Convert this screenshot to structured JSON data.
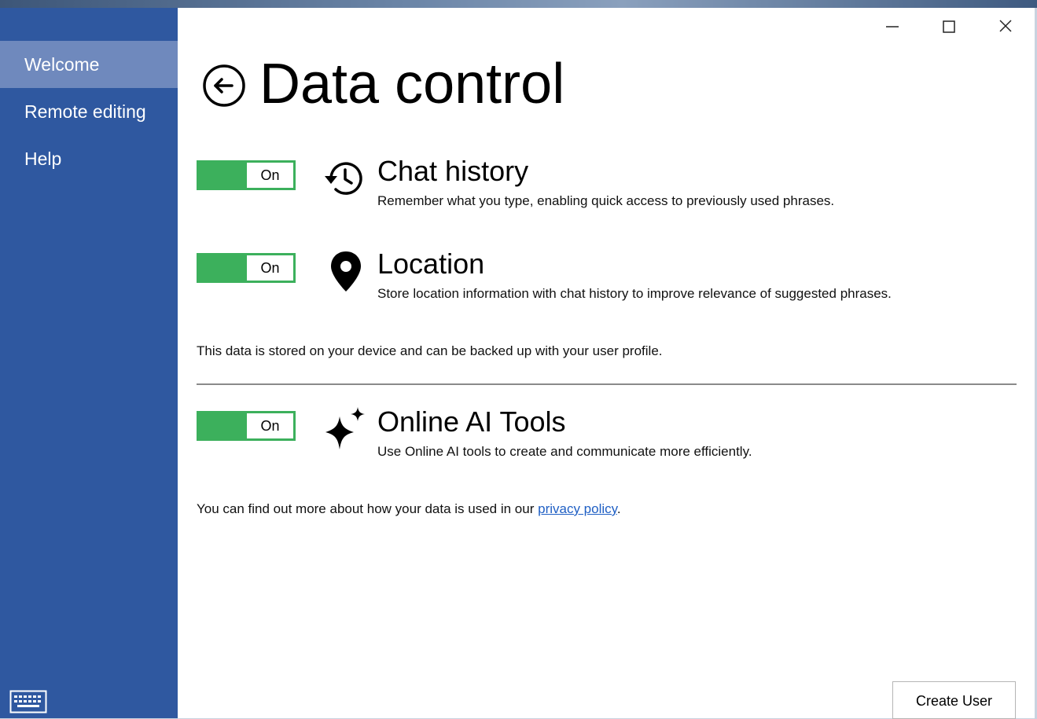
{
  "sidebar": {
    "items": [
      {
        "label": "Welcome",
        "active": true
      },
      {
        "label": "Remote editing",
        "active": false
      },
      {
        "label": "Help",
        "active": false
      }
    ]
  },
  "header": {
    "title": "Data control"
  },
  "settings": [
    {
      "title": "Chat history",
      "description": "Remember what you type, enabling quick access to previously used phrases.",
      "toggle": "On",
      "icon": "history-icon"
    },
    {
      "title": "Location",
      "description": "Store location information with chat history to improve relevance of suggested phrases.",
      "toggle": "On",
      "icon": "location-pin-icon"
    },
    {
      "title": "Online AI Tools",
      "description": "Use Online AI tools to create and communicate more efficiently.",
      "toggle": "On",
      "icon": "sparkle-icon"
    }
  ],
  "storage_note": "This data is stored on your device and can be backed up with your user profile.",
  "privacy_note": {
    "prefix": "You can find out more about how your data is used in our ",
    "link": "privacy policy",
    "suffix": "."
  },
  "footer": {
    "create_user_label": "Create User"
  },
  "colors": {
    "sidebar": "#2f58a0",
    "sidebar_active": "#6f89bd",
    "toggle_on": "#3cb05c",
    "link": "#1f5fc4"
  }
}
